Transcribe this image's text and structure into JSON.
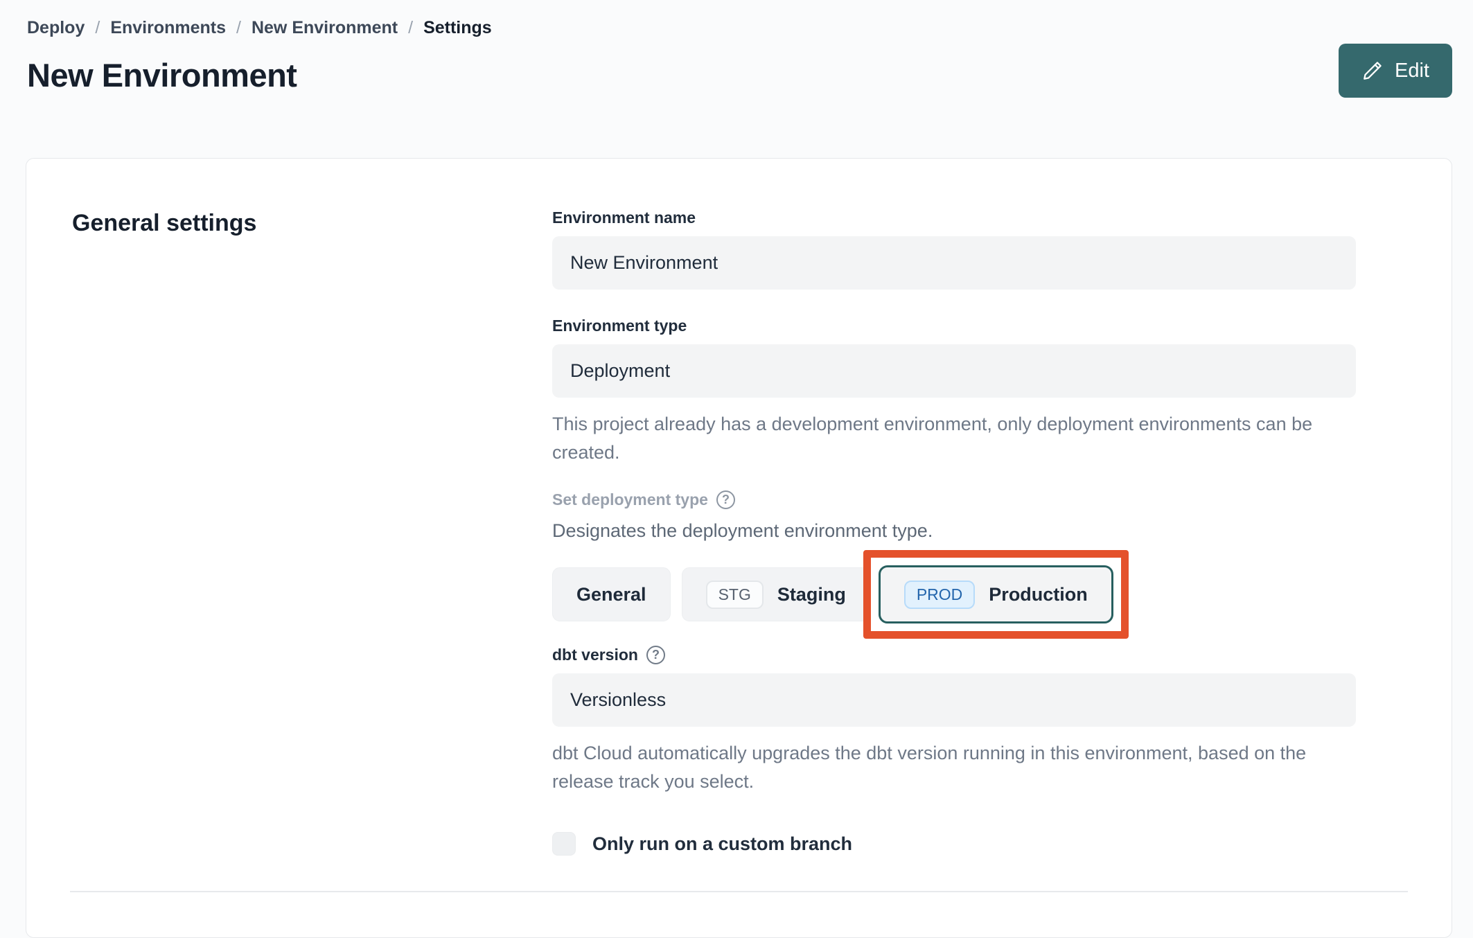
{
  "breadcrumb": {
    "separator": "/",
    "items": [
      "Deploy",
      "Environments",
      "New Environment",
      "Settings"
    ]
  },
  "header": {
    "title": "New Environment",
    "edit_button": "Edit"
  },
  "icons": {
    "help": "?"
  },
  "card": {
    "section_title": "General settings",
    "environment_name": {
      "label": "Environment name",
      "value": "New Environment"
    },
    "environment_type": {
      "label": "Environment type",
      "value": "Deployment",
      "helper": "This project already has a development environment, only deployment environments can be created."
    },
    "deployment_type": {
      "label": "Set deployment type",
      "description": "Designates the deployment environment type.",
      "options": [
        {
          "badge": "",
          "label": "General",
          "selected": false
        },
        {
          "badge": "STG",
          "label": "Staging",
          "selected": false
        },
        {
          "badge": "PROD",
          "label": "Production",
          "selected": true
        }
      ]
    },
    "dbt_version": {
      "label": "dbt version",
      "value": "Versionless",
      "helper": "dbt Cloud automatically upgrades the dbt version running in this environment, based on the release track you select."
    },
    "custom_branch": {
      "label": "Only run on a custom branch",
      "checked": false
    }
  },
  "colors": {
    "accent_teal": "#35696d",
    "selected_border_teal": "#275f5f",
    "highlight_orange": "#e4512b",
    "prod_badge_blue": "#2365ac",
    "prod_badge_bg": "#e2f1fd",
    "input_bg": "#f3f4f5"
  }
}
